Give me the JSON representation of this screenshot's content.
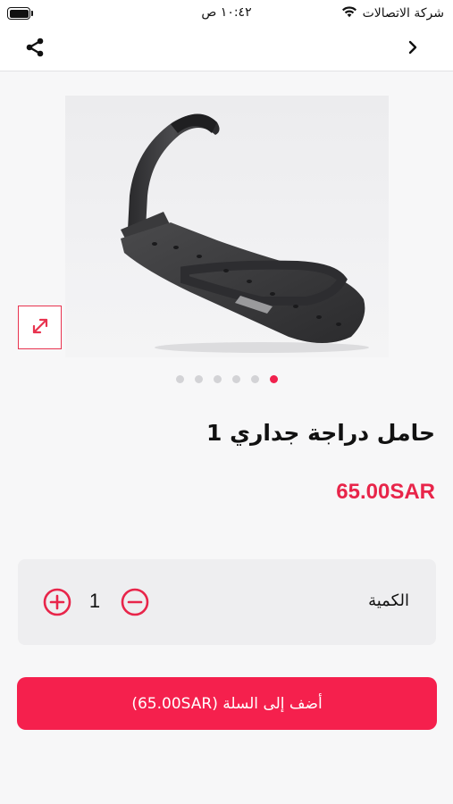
{
  "status_bar": {
    "carrier": "شركة الاتصالات",
    "time": "١٠:٤٢ ص"
  },
  "nav": {
    "share_icon": "share-icon",
    "back_icon": "chevron-right-icon"
  },
  "gallery": {
    "image_subject": "wall bike hook",
    "expand_icon": "expand-arrows-icon",
    "page_count": 6,
    "active_page": 6
  },
  "product": {
    "title": "حامل دراجة جداري 1",
    "price": "65.00SAR"
  },
  "quantity": {
    "label": "الكمية",
    "value": "1",
    "plus_icon": "plus-circle-icon",
    "minus_icon": "minus-circle-icon"
  },
  "cart": {
    "add_label": "أضف إلى السلة (65.00SAR)"
  },
  "colors": {
    "accent": "#f5204d",
    "price": "#e8254a"
  }
}
